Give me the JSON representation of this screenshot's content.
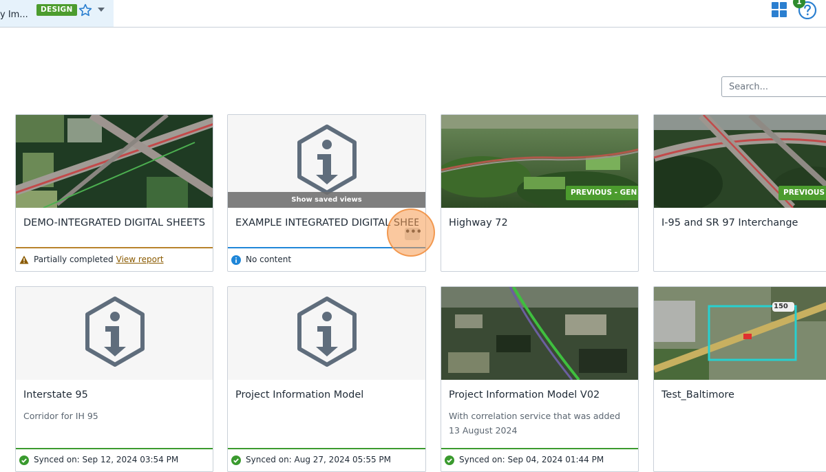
{
  "header": {
    "context_title": "y Im...",
    "design_badge": "DESIGN",
    "notification_count": "1"
  },
  "search": {
    "placeholder": "Search..."
  },
  "cards": [
    {
      "title": "DEMO-INTEGRATED DIGITAL SHEETS C...",
      "status_text": "Partially completed",
      "status_link": "View report",
      "status_color": "#b8822a"
    },
    {
      "title": "EXAMPLE INTEGRATED DIGITAL SHEETS",
      "overlay_label": "Show saved views",
      "status_text": "No content",
      "more_label": "•••",
      "status_color": "#1f86d8"
    },
    {
      "title": "Highway 72",
      "badge": "PREVIOUS - GEN"
    },
    {
      "title": "I-95 and SR 97 Interchange",
      "badge": "PREVIOUS - G"
    },
    {
      "title": "Interstate 95",
      "description": "Corridor for IH 95",
      "status_text": "Synced on: Sep 12, 2024 03:54 PM",
      "status_color": "#3a9a2e"
    },
    {
      "title": "Project Information Model",
      "status_text": "Synced on: Aug 27, 2024 05:55 PM",
      "status_color": "#3a9a2e"
    },
    {
      "title": "Project Information Model V02",
      "description": "With correlation service that was added 13 August 2024",
      "status_text": "Synced on: Sep 04, 2024 01:44 PM",
      "status_color": "#3a9a2e"
    },
    {
      "title": "Test_Baltimore",
      "map_label": "150"
    }
  ],
  "colors": {
    "accent": "#2b7fd0",
    "badge_green": "#4c9c2e"
  }
}
